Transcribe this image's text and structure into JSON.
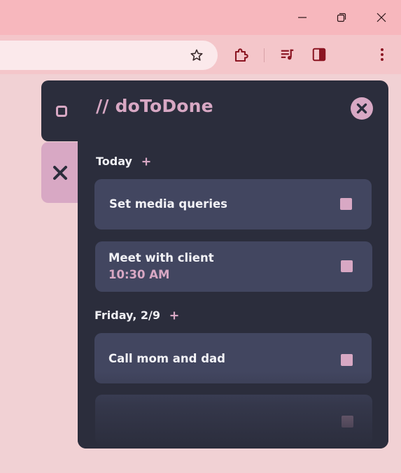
{
  "window": {
    "minimize_icon": "minimize-icon",
    "restore_icon": "restore-icon",
    "close_icon": "close-icon"
  },
  "toolbar": {
    "bookmark_icon": "star-icon",
    "extensions_icon": "puzzle-icon",
    "media_icon": "media-queue-icon",
    "side_panel_icon": "side-panel-icon",
    "menu_icon": "kebab-menu-icon"
  },
  "side_tabs": [
    {
      "icon": "checkbox-icon"
    },
    {
      "icon": "close-x-icon"
    }
  ],
  "app": {
    "title": "// doToDone",
    "close_icon": "close-circle-icon"
  },
  "sections": [
    {
      "label": "Today",
      "add_icon": "plus-icon",
      "tasks": [
        {
          "title": "Set media queries",
          "time": ""
        },
        {
          "title": "Meet with client",
          "time": "10:30 AM"
        }
      ]
    },
    {
      "label": "Friday, 2/9",
      "add_icon": "plus-icon",
      "tasks": [
        {
          "title": "Call mom and dad",
          "time": ""
        },
        {
          "title": "",
          "time": ""
        }
      ]
    }
  ],
  "colors": {
    "accent": "#d8a8c4",
    "panel_bg": "#2b2d3c",
    "card_bg": "#424660",
    "page_bg": "#f1d1d4",
    "titlebar": "#f7b7bd",
    "icon_dark": "#8b1522"
  }
}
